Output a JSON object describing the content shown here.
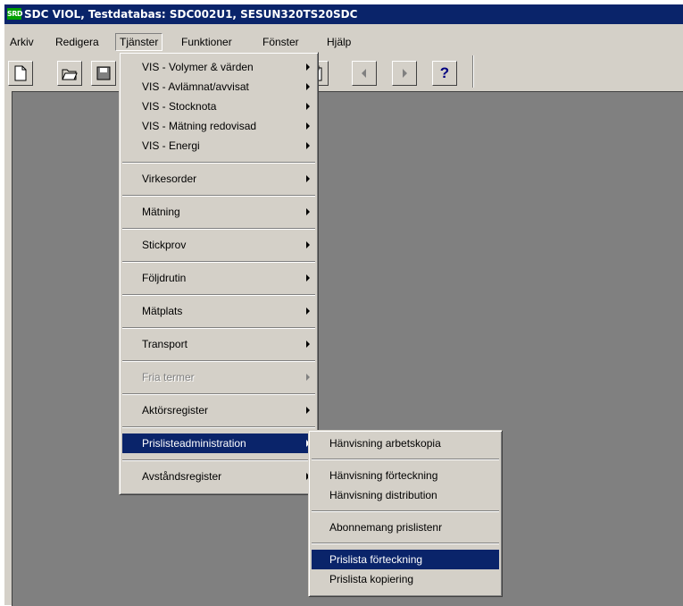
{
  "title": {
    "icon_text": "SRD",
    "text": "SDC VIOL, Testdatabas: SDC002U1, SESUN320TS20SDC"
  },
  "menubar": {
    "items": [
      {
        "label": "Arkiv"
      },
      {
        "label": "Redigera"
      },
      {
        "label": "Tjänster"
      },
      {
        "label": "Funktioner"
      },
      {
        "label": "Fönster"
      },
      {
        "label": "Hjälp"
      }
    ]
  },
  "toolbar": {
    "help_label": "?",
    "icons": [
      "new-document-icon",
      "open-folder-icon",
      "save-disk-icon",
      "paste-icon",
      "previous-icon",
      "next-icon",
      "help-icon"
    ]
  },
  "tjanster_menu": {
    "items": [
      {
        "label": "VIS - Volymer & värden"
      },
      {
        "label": "VIS - Avlämnat/avvisat"
      },
      {
        "label": "VIS - Stocknota"
      },
      {
        "label": "VIS - Mätning redovisad"
      },
      {
        "label": "VIS - Energi"
      },
      {
        "label": "Virkesorder"
      },
      {
        "label": "Mätning"
      },
      {
        "label": "Stickprov"
      },
      {
        "label": "Följdrutin"
      },
      {
        "label": "Mätplats"
      },
      {
        "label": "Transport"
      },
      {
        "label": "Fria termer",
        "disabled": true
      },
      {
        "label": "Aktörsregister"
      },
      {
        "label": "Prislisteadministration",
        "selected": true
      },
      {
        "label": "Avståndsregister"
      }
    ]
  },
  "prislist_submenu": {
    "items": [
      {
        "label": "Hänvisning arbetskopia"
      },
      {
        "label": "Hänvisning förteckning"
      },
      {
        "label": "Hänvisning distribution"
      },
      {
        "label": "Abonnemang prislistenr"
      },
      {
        "label": "Prislista förteckning",
        "selected": true
      },
      {
        "label": "Prislista kopiering"
      }
    ]
  },
  "colors": {
    "titlebar": "#0a246a",
    "selection": "#0a246a",
    "face": "#d4d0c8",
    "workspace": "#808080"
  }
}
